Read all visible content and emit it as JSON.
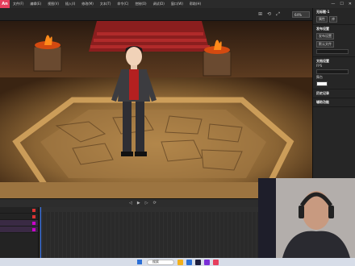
{
  "menu": [
    "文件(F)",
    "编辑(E)",
    "视图(V)",
    "插入(I)",
    "修改(M)",
    "文本(T)",
    "命令(C)",
    "控制(O)",
    "调试(D)",
    "窗口(W)",
    "帮助(H)"
  ],
  "app_logo": "An",
  "zoom_value": "64%",
  "timeline_controls": [
    "◁",
    "▶",
    "▷",
    "⟳"
  ],
  "layers": [
    {
      "color": "#d33"
    },
    {
      "color": "#d33"
    },
    {
      "color": "#c0c"
    },
    {
      "color": "#c0c"
    }
  ],
  "right_panel": {
    "doc_title": "无标题-1",
    "tabs": [
      "属性",
      "库"
    ],
    "section_publish": "发布设置",
    "btn_a": "发布设置",
    "btn_b": "默认文件",
    "section_doc": "文档设置",
    "label_fps": "FPS",
    "label_bg": "舞台",
    "section_history": "历史记录",
    "section_accessibility": "辅助功能"
  },
  "taskbar": {
    "search_label": "搜索"
  }
}
